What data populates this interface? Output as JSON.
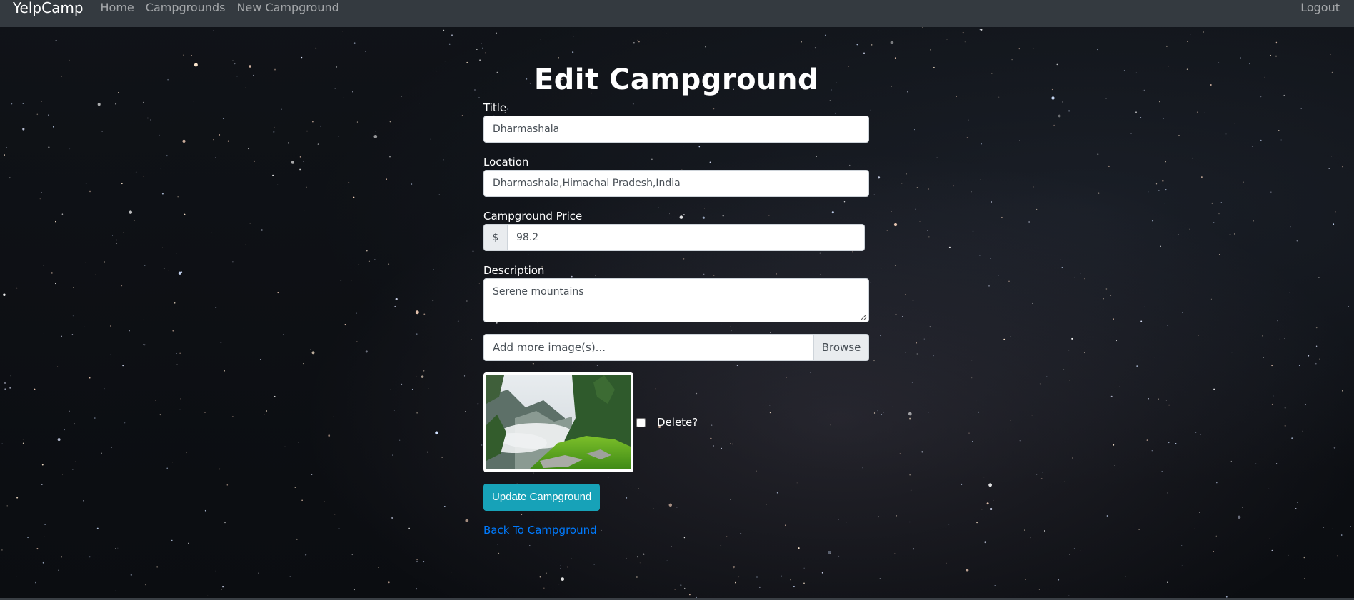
{
  "navbar": {
    "brand": "YelpCamp",
    "links": [
      "Home",
      "Campgrounds",
      "New Campground"
    ],
    "logout": "Logout"
  },
  "form": {
    "heading": "Edit Campground",
    "title_label": "Title",
    "title_value": "Dharmashala",
    "location_label": "Location",
    "location_value": "Dharmashala,Himachal Pradesh,India",
    "price_label": "Campground Price",
    "price_prefix": "$",
    "price_value": "98.2",
    "description_label": "Description",
    "description_value": "Serene mountains",
    "file_placeholder": "Add more image(s)...",
    "file_browse": "Browse",
    "delete_label": "Delete?",
    "delete_checked": false,
    "submit_label": "Update Campground",
    "back_link": "Back To Campground"
  },
  "colors": {
    "navbar_bg": "#343a40",
    "submit_bg": "#17a2b8",
    "link": "#007bff"
  },
  "icons": {
    "resize": "textarea-resize-icon",
    "thumbnail": "campground-thumbnail"
  }
}
